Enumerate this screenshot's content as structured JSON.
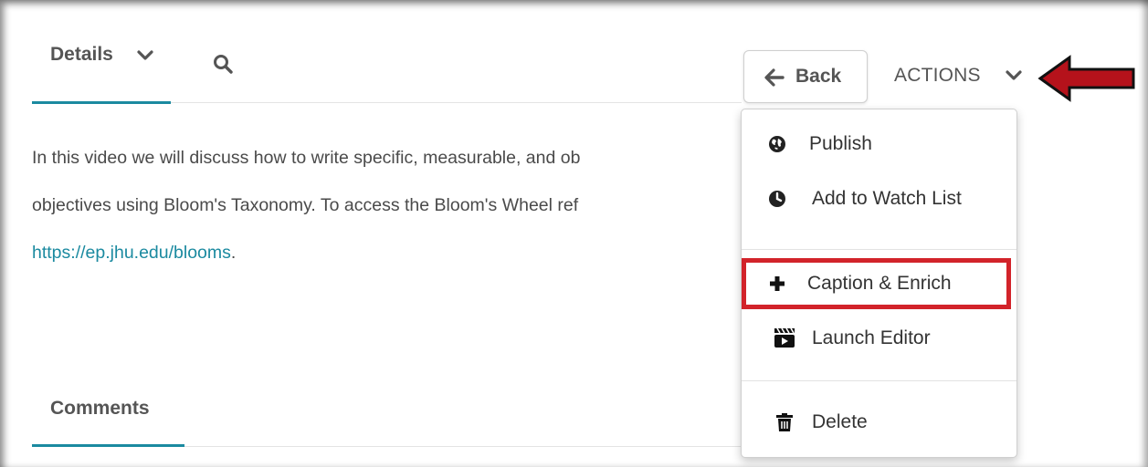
{
  "tabs": {
    "details_label": "Details",
    "comments_label": "Comments"
  },
  "toolbar": {
    "back_label": "Back",
    "actions_label": "ACTIONS"
  },
  "description": {
    "line1": "In this video we will discuss how to write specific, measurable, and ob",
    "line2": "objectives using Bloom's Taxonomy. To access the Bloom's Wheel ref",
    "link": "https://ep.jhu.edu/blooms",
    "link_trailing": "."
  },
  "menu": {
    "items": [
      {
        "label": "Publish",
        "icon": "globe-icon"
      },
      {
        "label": "Add to Watch List",
        "icon": "clock-icon"
      },
      {
        "label": "Caption & Enrich",
        "icon": "plus-icon"
      },
      {
        "label": "Launch Editor",
        "icon": "clapperboard-icon"
      },
      {
        "label": "Delete",
        "icon": "trash-icon"
      }
    ]
  },
  "colors": {
    "accent": "#1b8aa0",
    "highlight_red": "#d2232a",
    "arrow_red": "#b5121b"
  }
}
